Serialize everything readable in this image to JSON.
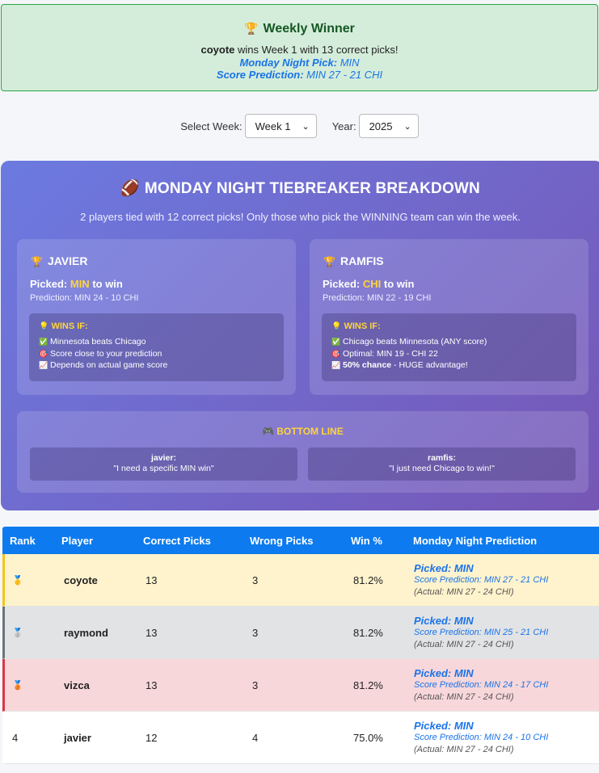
{
  "winner": {
    "icon": "trophy-icon",
    "title": "Weekly Winner",
    "player": "coyote",
    "text": " wins Week 1 with 13 correct picks!",
    "mn_label": "Monday Night Pick:",
    "mn_value": " MIN",
    "sp_label": "Score Prediction:",
    "sp_value": " MIN 27 - 21 CHI"
  },
  "selectors": {
    "week_label": "Select Week:",
    "week_value": "Week 1",
    "year_label": "Year:",
    "year_value": "2025"
  },
  "tiebreaker": {
    "title": "MONDAY NIGHT TIEBREAKER BREAKDOWN",
    "subtitle": "2 players tied with 12 correct picks! Only those who pick the WINNING team can win the week.",
    "cards": [
      {
        "name": "JAVIER",
        "picked_prefix": "Picked: ",
        "picked_team": "MIN",
        "picked_suffix": " to win",
        "prediction": "Prediction: MIN 24 - 10 CHI",
        "wins_title": "WINS IF:",
        "items": [
          {
            "icon": "check-icon",
            "text": "Minnesota beats Chicago"
          },
          {
            "icon": "target-icon",
            "text": "Score close to your prediction"
          },
          {
            "icon": "chart-icon",
            "text": "Depends on actual game score"
          }
        ]
      },
      {
        "name": "RAMFIS",
        "picked_prefix": "Picked: ",
        "picked_team": "CHI",
        "picked_suffix": " to win",
        "prediction": "Prediction: MIN 22 - 19 CHI",
        "wins_title": "WINS IF:",
        "items": [
          {
            "icon": "check-icon",
            "text": "Chicago beats Minnesota (ANY score)"
          },
          {
            "icon": "target-icon",
            "text": "Optimal: MIN 19 - CHI 22"
          },
          {
            "icon": "chart-icon",
            "bold": "50% chance",
            "text": " - HUGE advantage!"
          }
        ]
      }
    ],
    "bottom_title": "BOTTOM LINE",
    "quotes": [
      {
        "who": "javier:",
        "text": "\"I need a specific MIN win\""
      },
      {
        "who": "ramfis:",
        "text": "\"I just need Chicago to win!\""
      }
    ]
  },
  "table": {
    "headers": [
      "Rank",
      "Player",
      "Correct Picks",
      "Wrong Picks",
      "Win %",
      "Monday Night Prediction"
    ],
    "rows": [
      {
        "rank": "",
        "medal": "gold-medal-icon",
        "player": "coyote",
        "correct": "13",
        "wrong": "3",
        "win": "81.2%",
        "picked": "Picked: MIN",
        "score": "Score Prediction: MIN 27 - 21 CHI",
        "actual": "(Actual: MIN 27 - 24 CHI)"
      },
      {
        "rank": "",
        "medal": "silver-medal-icon",
        "player": "raymond",
        "correct": "13",
        "wrong": "3",
        "win": "81.2%",
        "picked": "Picked: MIN",
        "score": "Score Prediction: MIN 25 - 21 CHI",
        "actual": "(Actual: MIN 27 - 24 CHI)"
      },
      {
        "rank": "",
        "medal": "bronze-medal-icon",
        "player": "vizca",
        "correct": "13",
        "wrong": "3",
        "win": "81.2%",
        "picked": "Picked: MIN",
        "score": "Score Prediction: MIN 24 - 17 CHI",
        "actual": "(Actual: MIN 27 - 24 CHI)"
      },
      {
        "rank": "4",
        "medal": "",
        "player": "javier",
        "correct": "12",
        "wrong": "4",
        "win": "75.0%",
        "picked": "Picked: MIN",
        "score": "Score Prediction: MIN 24 - 10 CHI",
        "actual": "(Actual: MIN 27 - 24 CHI)"
      }
    ]
  }
}
